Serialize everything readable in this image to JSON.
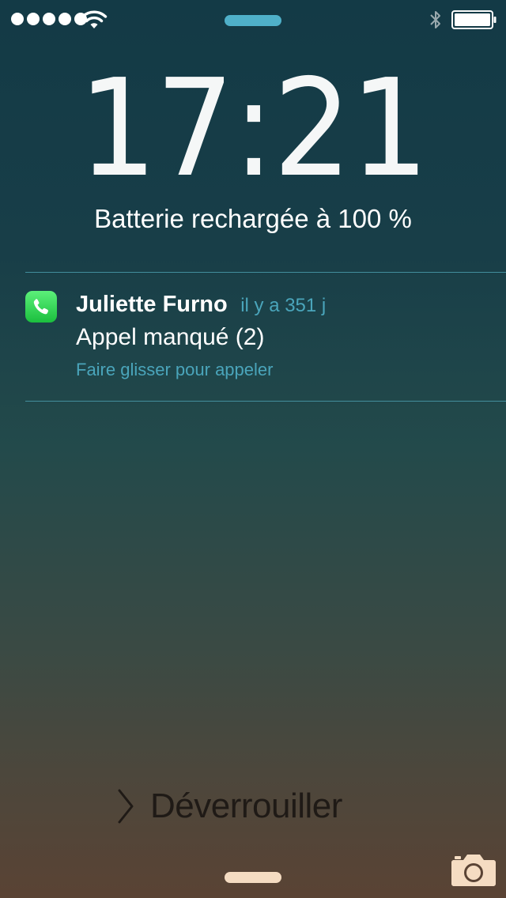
{
  "status_bar": {
    "signal_dots": 5,
    "icons": [
      "wifi-icon",
      "grabber-handle",
      "bluetooth-icon",
      "battery-icon"
    ],
    "battery_level": 1.0
  },
  "lock_screen": {
    "time": "17:21",
    "battery_message": "Batterie rechargée à 100 %"
  },
  "notification": {
    "app_icon": "phone-icon",
    "sender": "Juliette Furno",
    "time_ago": "il y a 351 j",
    "message": "Appel manqué (2)",
    "hint": "Faire glisser pour appeler"
  },
  "unlock": {
    "label": "Déverrouiller",
    "icon": "chevron-right-icon"
  },
  "camera": {
    "icon": "camera-icon"
  },
  "colors": {
    "accent_teal": "#4aa5bb",
    "grabber_top": "#4fb0c9",
    "grabber_bottom": "#f5dcc2",
    "phone_green": "#1bbf3e"
  }
}
